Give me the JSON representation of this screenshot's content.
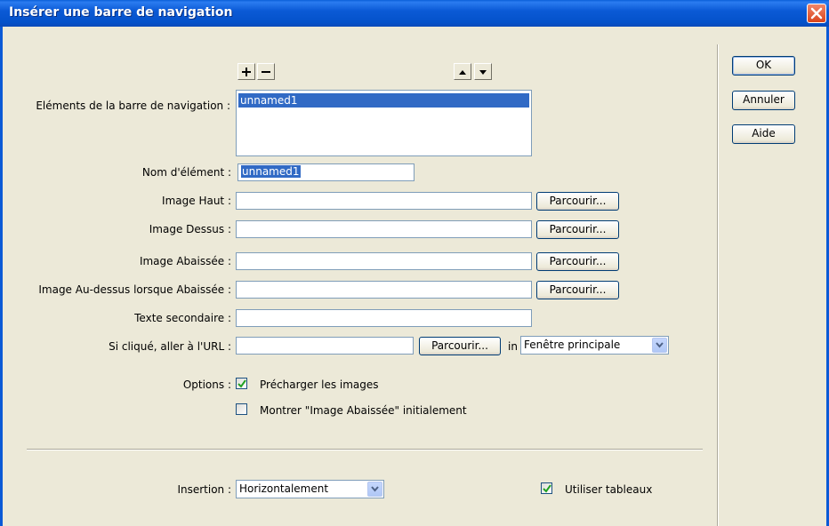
{
  "window": {
    "title": "Insérer une barre de navigation"
  },
  "nav_items": {
    "label": "Eléments de la barre de navigation :",
    "items": [
      "unnamed1"
    ]
  },
  "fields": {
    "element_name_label": "Nom d'élément :",
    "element_name_value": "unnamed1",
    "up_image_label": "Image Haut :",
    "over_image_label": "Image Dessus :",
    "down_image_label": "Image Abaissée :",
    "over_while_down_label": "Image Au-dessus lorsque Abaissée :",
    "alt_text_label": "Texte secondaire :",
    "url_label": "Si cliqué, aller à l'URL :",
    "url_in_label": "in",
    "url_target_value": "Fenêtre principale",
    "browse_label": "Parcourir..."
  },
  "options": {
    "label": "Options :",
    "preload_label": "Précharger les images",
    "preload_checked": true,
    "show_down_label": "Montrer \"Image Abaissée\" initialement",
    "show_down_checked": false
  },
  "insertion": {
    "label": "Insertion :",
    "value": "Horizontalement",
    "use_tables_label": "Utiliser tableaux",
    "use_tables_checked": true
  },
  "buttons": {
    "ok": "OK",
    "cancel": "Annuler",
    "help": "Aide"
  }
}
